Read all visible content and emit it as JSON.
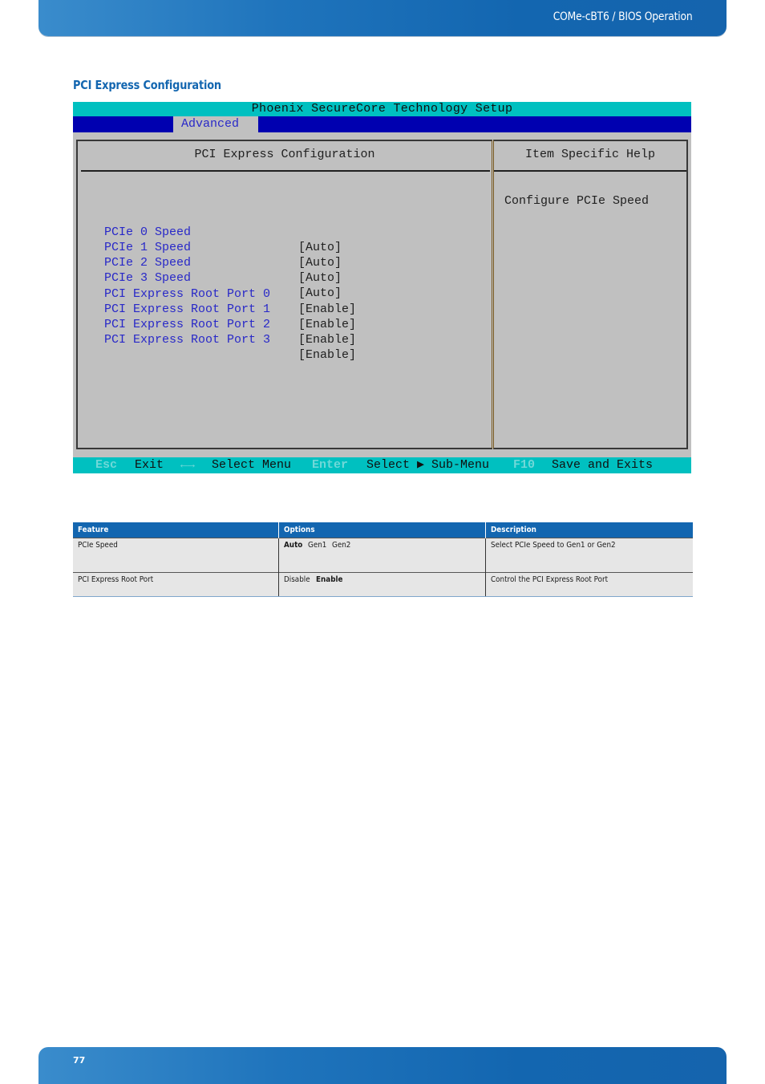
{
  "header": {
    "title": "COMe-cBT6 / BIOS Operation"
  },
  "section": {
    "title": "PCI Express Configuration"
  },
  "bios": {
    "title": "Phoenix SecureCore Technology Setup",
    "active_tab": "Advanced",
    "panel_heading": "PCI Express Configuration",
    "help_heading": "Item Specific Help",
    "help_text": "Configure PCIe Speed",
    "items": [
      {
        "label": "PCIe 0 Speed",
        "value": "[Auto]"
      },
      {
        "label": "PCIe 1 Speed",
        "value": "[Auto]"
      },
      {
        "label": "PCIe 2 Speed",
        "value": "[Auto]"
      },
      {
        "label": "PCIe 3 Speed",
        "value": "[Auto]"
      },
      {
        "label": "PCI Express Root Port 0",
        "value": "[Enable]"
      },
      {
        "label": "PCI Express Root Port 1",
        "value": "[Enable]"
      },
      {
        "label": "PCI Express Root Port 2",
        "value": "[Enable]"
      },
      {
        "label": "PCI Express Root Port 3",
        "value": "[Enable]"
      }
    ],
    "status_bar": {
      "esc_key": "Esc",
      "esc_action": "Exit",
      "arrows_key": "←→",
      "arrows_action": "Select Menu",
      "enter_key": "Enter",
      "enter_action": "Select ▶ Sub-Menu",
      "f10_key": "F10",
      "f10_action": "Save and Exits"
    }
  },
  "table": {
    "headers": [
      "Feature",
      "Options",
      "Description"
    ],
    "rows": [
      {
        "feature": "PCIe Speed",
        "options": [
          {
            "label": "Auto",
            "default": true
          },
          {
            "label": "Gen1",
            "default": false
          },
          {
            "label": "Gen2",
            "default": false
          }
        ],
        "description": "Select PCIe Speed to Gen1 or Gen2"
      },
      {
        "feature": "PCI Express Root Port",
        "options": [
          {
            "label": "Disable",
            "default": false
          },
          {
            "label": "Enable",
            "default": true
          }
        ],
        "description": "Control the PCI Express Root Port"
      }
    ]
  },
  "footer": {
    "page_number": "77"
  }
}
